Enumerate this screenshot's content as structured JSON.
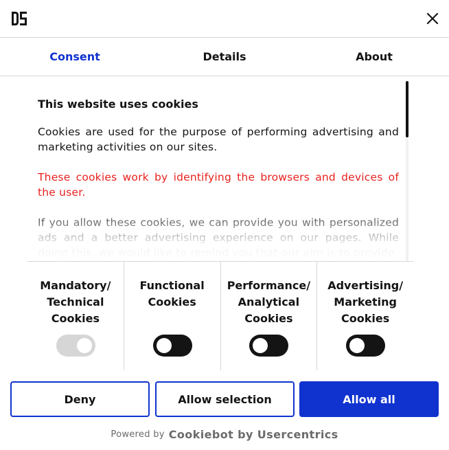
{
  "header": {
    "logo_text": "DS",
    "logo_icon": "ds-logo",
    "close_icon": "close-icon"
  },
  "tabs": [
    {
      "label": "Consent",
      "active": true
    },
    {
      "label": "Details",
      "active": false
    },
    {
      "label": "About",
      "active": false
    }
  ],
  "content": {
    "heading": "This website uses cookies",
    "paragraphs": [
      "Cookies are used for the purpose of performing advertising and marketing activities on our sites.",
      "These cookies work by identifying the browsers and devices of the user.",
      "If you allow these cookies, we can provide you with personalized ads and a better advertising experience on our pages. While doing this, we would like to remind you that our aim is to provide"
    ]
  },
  "categories": [
    {
      "label": "Mandatory/ Technical Cookies",
      "state": "on",
      "disabled": true
    },
    {
      "label": "Functional Cookies",
      "state": "off",
      "disabled": false
    },
    {
      "label": "Performance/ Analytical Cookies",
      "state": "off",
      "disabled": false
    },
    {
      "label": "Advertising/ Marketing Cookies",
      "state": "off",
      "disabled": false
    }
  ],
  "buttons": {
    "deny": "Deny",
    "allow_selection": "Allow selection",
    "allow_all": "Allow all"
  },
  "footer": {
    "powered_by": "Powered by",
    "brand": "Cookiebot by Usercentrics"
  },
  "colors": {
    "accent": "#1032cf",
    "warning_text": "#e8221f",
    "toggle_on_disabled": "#d6d6d6",
    "toggle_off": "#141414"
  }
}
